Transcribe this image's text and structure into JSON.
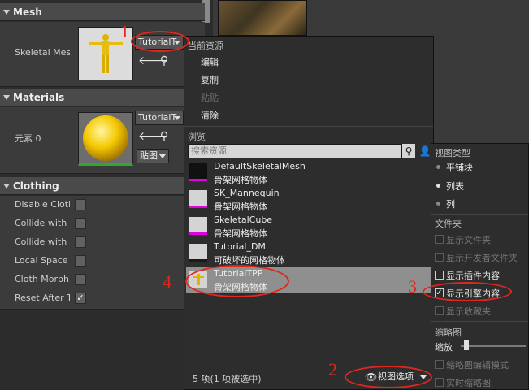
{
  "details": {
    "mesh": {
      "header": "Mesh",
      "label": "Skeletal Mesh",
      "combo_value": "TutorialT"
    },
    "materials": {
      "header": "Materials",
      "label": "元素 0",
      "combo_value": "TutorialT",
      "texture_button": "贴图"
    },
    "clothing": {
      "header": "Clothing",
      "items": [
        {
          "label": "Disable Cloth",
          "checked": false
        },
        {
          "label": "Collide with E",
          "checked": false
        },
        {
          "label": "Collide with A",
          "checked": false
        },
        {
          "label": "Local Space S",
          "checked": false
        },
        {
          "label": "Cloth Morph T",
          "checked": false
        },
        {
          "label": "Reset After T",
          "checked": true
        }
      ]
    }
  },
  "popup": {
    "current_asset_group": "当前资源",
    "menu": {
      "edit": "编辑",
      "copy": "复制",
      "paste": "粘贴",
      "clear": "清除"
    },
    "browse_group": "浏览",
    "search_placeholder": "搜索资源",
    "assets": [
      {
        "name": "DefaultSkeletalMesh",
        "type": "骨架网格物体",
        "selected": false
      },
      {
        "name": "SK_Mannequin",
        "type": "骨架网格物体",
        "selected": false
      },
      {
        "name": "SkeletalCube",
        "type": "骨架网格物体",
        "selected": false
      },
      {
        "name": "Tutorial_DM",
        "type": "可破坏的网格物体",
        "selected": false
      },
      {
        "name": "TutorialTPP",
        "type": "骨架网格物体",
        "selected": true
      }
    ],
    "status": "5 项(1 项被选中)",
    "view_options": "视图选项"
  },
  "view_menu": {
    "view_type_group": "视图类型",
    "tiles": "平铺块",
    "list": "列表",
    "columns": "列",
    "folders_group": "文件夹",
    "show_folders": "显示文件夹",
    "show_dev_folders": "显示开发者文件夹",
    "show_plugin": "显示插件内容",
    "show_engine": "显示引擎内容",
    "show_collections": "显示收藏夹",
    "thumbnail_group": "缩略图",
    "scale": "缩放",
    "thumb_edit_mode": "缩略图编辑模式",
    "realtime_thumb": "实时缩略图"
  },
  "annotations": [
    "1",
    "2",
    "3",
    "4"
  ],
  "colors": {
    "annotation": "#e0271e",
    "selection_bar": "#e000e0",
    "selected_row": "#8f8f8f"
  }
}
